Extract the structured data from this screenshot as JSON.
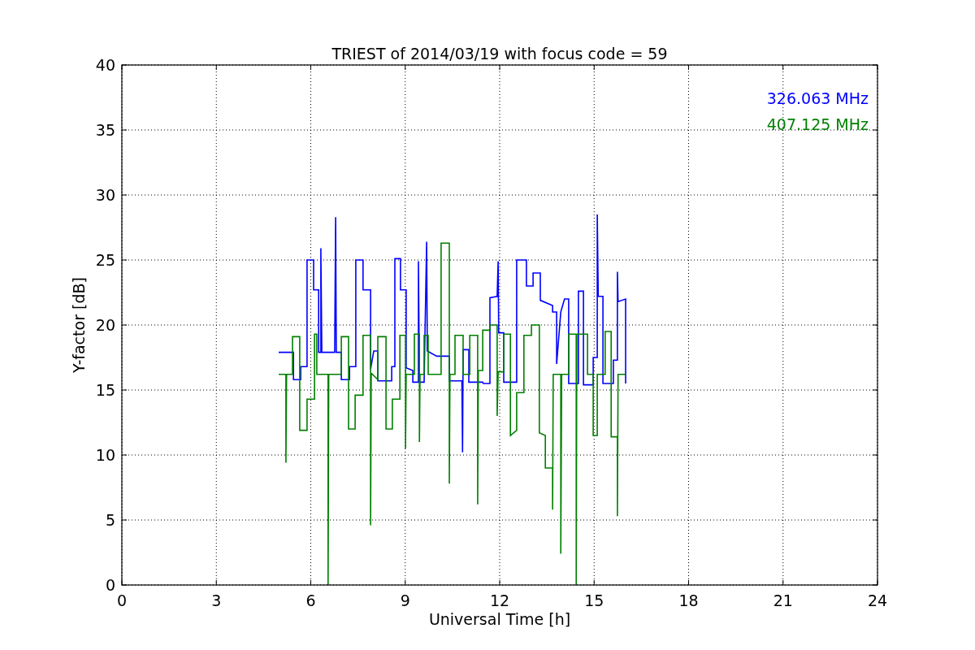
{
  "chart": {
    "chart_data": {
      "type": "line",
      "grid": true,
      "title": "TRIEST of 2014/03/19 with focus code = 59",
      "xlabel": "Universal Time [h]",
      "ylabel": "Y-factor [dB]",
      "xlim": [
        0,
        24
      ],
      "ylim": [
        0,
        40
      ],
      "xticks": [
        0,
        3,
        6,
        9,
        12,
        15,
        18,
        21,
        24
      ],
      "yticks": [
        0,
        5,
        10,
        15,
        20,
        25,
        30,
        35,
        40
      ],
      "series": [
        {
          "name": "326.063 MHz",
          "color": "#0000ff",
          "x": [
            4.98,
            5.45,
            5.45,
            5.68,
            5.68,
            5.88,
            5.88,
            6.09,
            6.09,
            6.25,
            6.25,
            6.32,
            6.32,
            6.35,
            6.76,
            6.79,
            6.81,
            6.97,
            6.97,
            7.23,
            7.23,
            7.43,
            7.43,
            7.66,
            7.66,
            7.9,
            7.9,
            8.0,
            8.13,
            8.13,
            8.57,
            8.57,
            8.67,
            8.67,
            8.85,
            8.85,
            9.03,
            9.03,
            9.24,
            9.24,
            9.42,
            9.42,
            9.45,
            9.6,
            9.68,
            9.7,
            10.0,
            10.4,
            10.4,
            10.8,
            10.82,
            10.84,
            11.02,
            11.02,
            11.46,
            11.48,
            11.69,
            11.69,
            11.92,
            11.95,
            11.97,
            12.13,
            12.13,
            12.54,
            12.54,
            12.85,
            12.85,
            13.06,
            13.06,
            13.29,
            13.29,
            13.68,
            13.68,
            13.81,
            13.81,
            13.94,
            14.06,
            14.19,
            14.19,
            14.5,
            14.5,
            14.66,
            14.66,
            14.97,
            14.97,
            15.1,
            15.1,
            15.13,
            15.28,
            15.28,
            15.61,
            15.61,
            15.74,
            15.74,
            15.76,
            16.0,
            16.0
          ],
          "values": [
            17.9,
            17.9,
            15.8,
            15.8,
            16.8,
            16.8,
            25,
            25,
            22.7,
            22.7,
            17.9,
            17.9,
            25.9,
            17.9,
            17.9,
            28.3,
            17.9,
            17.9,
            15.8,
            15.8,
            16.8,
            16.8,
            25,
            25,
            22.7,
            22.7,
            16.6,
            18,
            18,
            15.7,
            15.7,
            16.8,
            16.8,
            25.1,
            25.1,
            22.7,
            22.7,
            16.7,
            16.5,
            15.6,
            15.6,
            24.9,
            15.6,
            15.6,
            26.4,
            18,
            17.6,
            17.6,
            15.7,
            15.7,
            10.2,
            18.1,
            18.1,
            15.6,
            15.6,
            15.5,
            15.5,
            22.1,
            22.2,
            24.9,
            19.4,
            19.4,
            15.6,
            15.6,
            25,
            25,
            23,
            23,
            24,
            24,
            21.9,
            21.5,
            21,
            21,
            17,
            21,
            22,
            22,
            15.5,
            15.5,
            22.6,
            22.6,
            15.4,
            15.4,
            17.5,
            17.5,
            28.5,
            22.2,
            22.2,
            15.5,
            15.5,
            17.3,
            17.3,
            24.1,
            21.8,
            22,
            15.5
          ]
        },
        {
          "name": "407.125 MHz",
          "color": "#008000",
          "x": [
            4.98,
            5.21,
            5.21,
            5.23,
            5.42,
            5.42,
            5.65,
            5.65,
            5.88,
            5.88,
            6.12,
            6.12,
            6.19,
            6.19,
            6.55,
            6.55,
            6.57,
            6.97,
            6.97,
            7.2,
            7.2,
            7.41,
            7.41,
            7.66,
            7.66,
            7.9,
            7.9,
            7.92,
            8.13,
            8.13,
            8.39,
            8.39,
            8.59,
            8.59,
            8.83,
            8.83,
            9.01,
            9.01,
            9.03,
            9.29,
            9.29,
            9.45,
            9.45,
            9.47,
            9.6,
            9.6,
            9.73,
            9.73,
            10.14,
            10.14,
            10.4,
            10.4,
            10.42,
            10.58,
            10.58,
            10.84,
            10.84,
            11.05,
            11.05,
            11.3,
            11.3,
            11.32,
            11.46,
            11.46,
            11.69,
            11.69,
            11.92,
            11.92,
            11.95,
            12.13,
            12.13,
            12.34,
            12.34,
            12.54,
            12.54,
            12.77,
            12.77,
            13.01,
            13.01,
            13.26,
            13.26,
            13.45,
            13.45,
            13.68,
            13.68,
            13.7,
            13.94,
            13.94,
            13.97,
            14.19,
            14.19,
            14.43,
            14.43,
            14.45,
            14.79,
            14.79,
            14.97,
            14.97,
            15.1,
            15.1,
            15.35,
            15.35,
            15.54,
            15.54,
            15.74,
            15.74,
            15.76,
            16.0
          ],
          "values": [
            16.2,
            16.2,
            9.4,
            16.2,
            16.2,
            19.1,
            19.1,
            11.9,
            11.9,
            14.3,
            14.3,
            19.3,
            19.3,
            16.2,
            16.2,
            0,
            16.2,
            16.2,
            19.1,
            19.1,
            12,
            12,
            14.6,
            14.6,
            19.2,
            19.2,
            4.6,
            16.3,
            15.8,
            19.1,
            19.1,
            12,
            12,
            14.3,
            14.3,
            19.2,
            19.2,
            10.5,
            16.2,
            16.2,
            19.3,
            19.3,
            11,
            16.2,
            16.2,
            19.2,
            19.2,
            16.2,
            16.2,
            26.3,
            26.3,
            7.8,
            16.2,
            16.2,
            19.2,
            19.2,
            16.2,
            16.2,
            19.2,
            19.2,
            6.2,
            16.5,
            16.5,
            19.6,
            19.6,
            20,
            20,
            13,
            16.4,
            16.4,
            19.3,
            19.3,
            11.5,
            11.9,
            14.8,
            14.8,
            19.2,
            19.2,
            20,
            20,
            11.7,
            11.5,
            9,
            9,
            5.8,
            16.2,
            16.2,
            2.4,
            16.2,
            16.2,
            19.3,
            19.3,
            0,
            19.3,
            19.3,
            16.2,
            16.2,
            11.5,
            11.5,
            16.2,
            16.2,
            19.5,
            19.5,
            11.4,
            11.4,
            5.3,
            16.2,
            16.2
          ]
        }
      ]
    }
  }
}
